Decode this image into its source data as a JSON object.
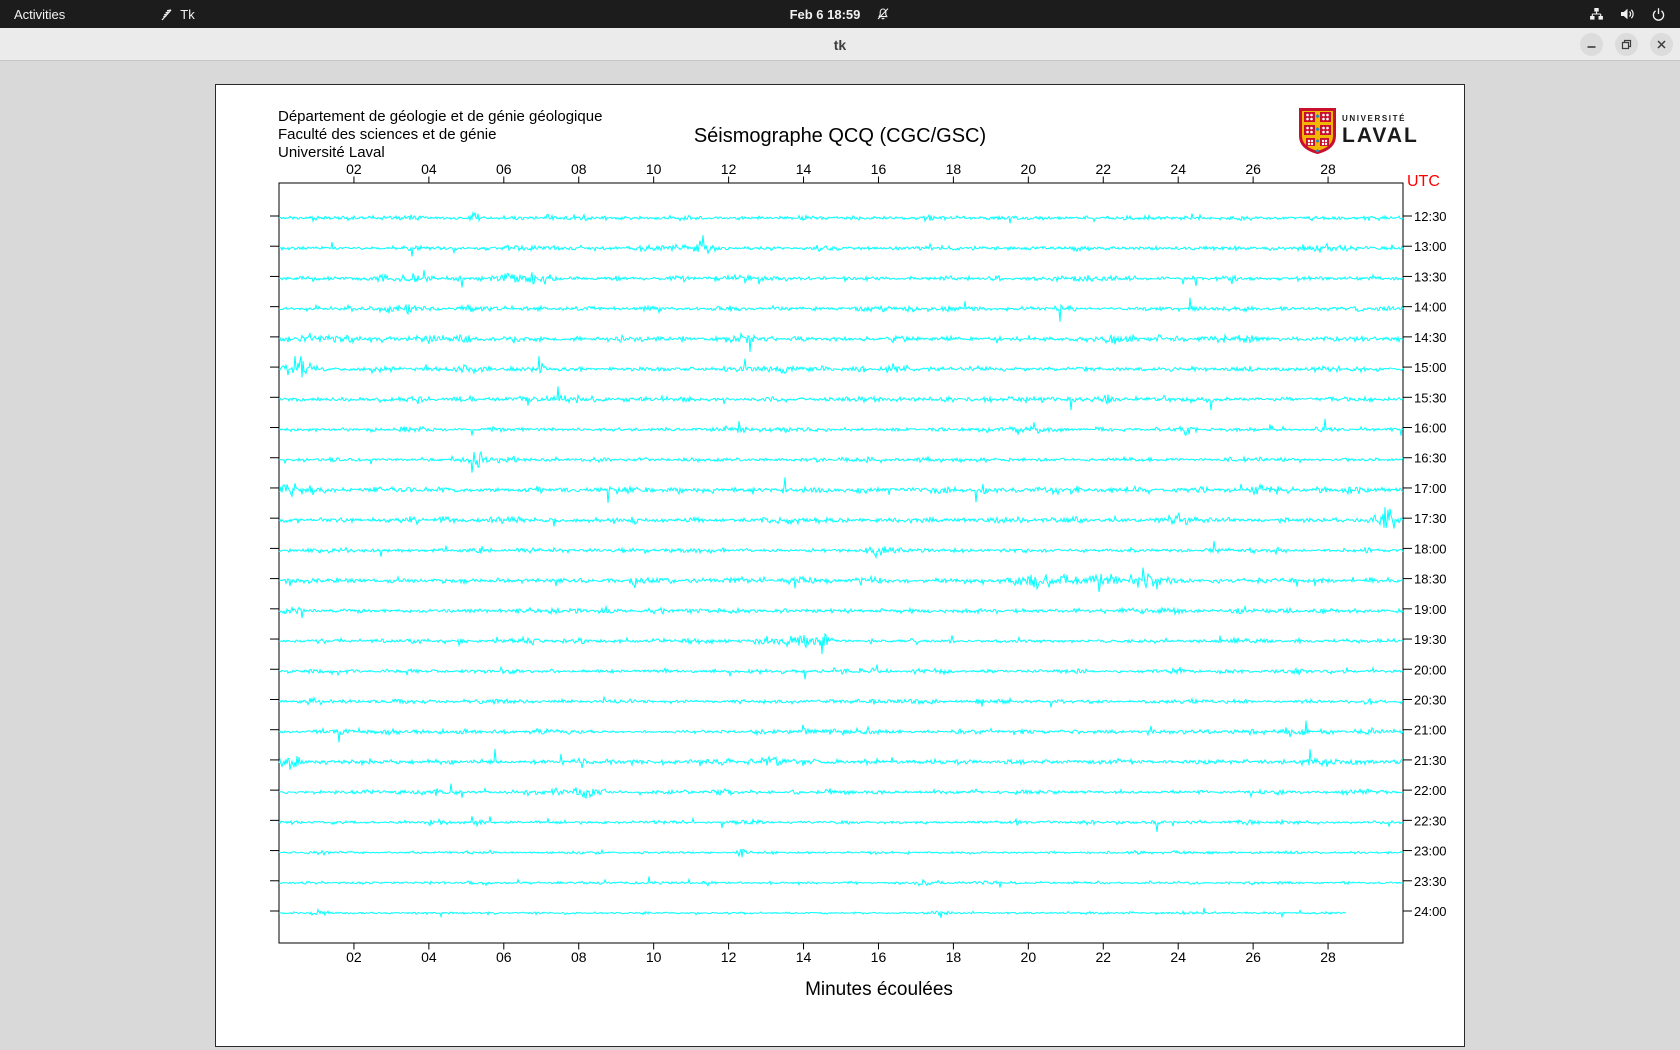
{
  "system_bar": {
    "activities_label": "Activities",
    "app_indicator_label": "Tk",
    "clock": "Feb 6 18:59",
    "icons": [
      "tk-feather-icon",
      "notifications-muted-icon",
      "network-wired-icon",
      "volume-icon",
      "power-icon"
    ]
  },
  "window": {
    "title": "tk",
    "controls": [
      "minimize",
      "restore",
      "close"
    ]
  },
  "header": {
    "institution_lines": [
      "Département de géologie et de génie géologique",
      "Faculté des sciences et de génie",
      "Université Laval"
    ],
    "title": "Séismographe QCQ (CGC/GSC)",
    "logo": {
      "top_text": "UNIVERSITÉ",
      "bottom_text": "LAVAL"
    }
  },
  "colors": {
    "trace": "#00ffff",
    "utc_label": "#ff0000",
    "axis": "#000000",
    "topbar": "#1c1c1c",
    "headerbar": "#ebebeb",
    "tk_background": "#d9d9d9"
  },
  "chart_data": {
    "type": "line",
    "subtype": "helicorder-seismogram",
    "title": "Séismographe QCQ (CGC/GSC)",
    "xlabel": "Minutes écoulées",
    "right_axis_label": "UTC",
    "x_range_minutes": [
      0,
      30
    ],
    "x_tick_step_minutes": 2,
    "x_ticks": [
      "02",
      "04",
      "06",
      "08",
      "10",
      "12",
      "14",
      "16",
      "18",
      "20",
      "22",
      "24",
      "26",
      "28"
    ],
    "row_interval_minutes": 30,
    "rows": [
      {
        "label": "12:30",
        "seed": 11,
        "activity": 0.95,
        "end": 30,
        "events": [
          [
            5.2,
            0.12,
            4.0
          ],
          [
            17.3,
            0.1,
            3.2
          ],
          [
            25.8,
            0.1,
            2.8
          ]
        ]
      },
      {
        "label": "13:00",
        "seed": 23,
        "activity": 0.95,
        "end": 30,
        "events": [
          [
            11.3,
            0.1,
            2.8
          ],
          [
            27.9,
            0.4,
            2.4
          ]
        ]
      },
      {
        "label": "13:30",
        "seed": 37,
        "activity": 1.1,
        "end": 30,
        "events": [
          [
            6.3,
            0.5,
            2.2
          ],
          [
            12.8,
            0.1,
            2.8
          ]
        ]
      },
      {
        "label": "14:00",
        "seed": 41,
        "activity": 1.0,
        "end": 30,
        "events": [
          [
            3.2,
            0.4,
            2.2
          ],
          [
            16.3,
            0.1,
            2.8
          ]
        ]
      },
      {
        "label": "14:30",
        "seed": 53,
        "activity": 1.2,
        "end": 30,
        "events": [
          [
            4.2,
            0.2,
            2.4
          ],
          [
            12.5,
            0.3,
            2.2
          ],
          [
            22.5,
            0.2,
            2.4
          ]
        ]
      },
      {
        "label": "15:00",
        "seed": 67,
        "activity": 1.2,
        "end": 30,
        "events": [
          [
            0.5,
            0.3,
            2.5
          ],
          [
            16.4,
            0.2,
            2.2
          ]
        ]
      },
      {
        "label": "15:30",
        "seed": 71,
        "activity": 1.1,
        "end": 30,
        "events": [
          [
            22.0,
            0.15,
            3.0
          ]
        ]
      },
      {
        "label": "16:00",
        "seed": 83,
        "activity": 0.9,
        "end": 30,
        "events": [
          [
            24.2,
            0.12,
            2.6
          ]
        ]
      },
      {
        "label": "16:30",
        "seed": 97,
        "activity": 0.9,
        "end": 30,
        "events": [
          [
            5.3,
            0.1,
            3.2
          ],
          [
            15.8,
            0.1,
            2.6
          ]
        ]
      },
      {
        "label": "17:00",
        "seed": 101,
        "activity": 1.3,
        "end": 30,
        "events": [
          [
            0.3,
            0.4,
            2.5
          ],
          [
            26.5,
            0.4,
            2.3
          ]
        ]
      },
      {
        "label": "17:30",
        "seed": 113,
        "activity": 1.2,
        "end": 30,
        "events": [
          [
            3.6,
            0.12,
            3.0
          ],
          [
            24.0,
            0.3,
            2.3
          ],
          [
            29.5,
            0.15,
            3.2
          ]
        ]
      },
      {
        "label": "18:00",
        "seed": 127,
        "activity": 1.0,
        "end": 30,
        "events": [
          [
            16.0,
            0.1,
            2.7
          ]
        ]
      },
      {
        "label": "18:30",
        "seed": 131,
        "activity": 1.25,
        "end": 30,
        "events": [
          [
            9.4,
            0.1,
            2.6
          ],
          [
            20.8,
            0.9,
            2.8
          ],
          [
            23.1,
            0.5,
            2.4
          ]
        ]
      },
      {
        "label": "19:00",
        "seed": 139,
        "activity": 1.0,
        "end": 30,
        "events": [
          [
            0.2,
            0.2,
            2.5
          ],
          [
            10.2,
            0.1,
            2.6
          ]
        ]
      },
      {
        "label": "19:30",
        "seed": 149,
        "activity": 0.95,
        "end": 30,
        "events": [
          [
            13.6,
            0.5,
            2.2
          ],
          [
            14.55,
            0.1,
            6.5
          ],
          [
            17.0,
            0.1,
            2.7
          ]
        ]
      },
      {
        "label": "20:00",
        "seed": 151,
        "activity": 0.85,
        "end": 30,
        "events": [
          [
            3.5,
            0.12,
            2.6
          ],
          [
            24.0,
            0.1,
            2.6
          ]
        ]
      },
      {
        "label": "20:30",
        "seed": 163,
        "activity": 0.9,
        "end": 30,
        "events": [
          [
            1.0,
            0.15,
            2.7
          ],
          [
            18.7,
            0.1,
            2.4
          ]
        ]
      },
      {
        "label": "21:00",
        "seed": 173,
        "activity": 1.0,
        "end": 30,
        "events": [
          [
            1.7,
            0.12,
            2.7
          ],
          [
            27.0,
            0.3,
            2.4
          ]
        ]
      },
      {
        "label": "21:30",
        "seed": 181,
        "activity": 1.2,
        "end": 30,
        "events": [
          [
            0.3,
            0.2,
            2.7
          ],
          [
            13.1,
            0.2,
            2.4
          ],
          [
            27.8,
            0.3,
            2.5
          ]
        ]
      },
      {
        "label": "22:00",
        "seed": 193,
        "activity": 0.9,
        "end": 30,
        "events": [
          [
            8.1,
            0.2,
            2.5
          ],
          [
            19.9,
            0.12,
            2.6
          ]
        ]
      },
      {
        "label": "22:30",
        "seed": 199,
        "activity": 0.8,
        "end": 30,
        "events": [
          [
            4.1,
            0.2,
            2.4
          ]
        ]
      },
      {
        "label": "23:00",
        "seed": 211,
        "activity": 0.6,
        "end": 30,
        "events": [
          [
            12.3,
            0.08,
            3.0
          ],
          [
            24.8,
            0.1,
            2.6
          ]
        ]
      },
      {
        "label": "23:30",
        "seed": 223,
        "activity": 0.6,
        "end": 30,
        "events": [
          [
            11.5,
            0.1,
            3.0
          ],
          [
            17.2,
            0.1,
            2.6
          ],
          [
            24.5,
            0.1,
            2.6
          ]
        ]
      },
      {
        "label": "24:00",
        "seed": 229,
        "activity": 0.55,
        "end": 28.5,
        "events": [
          [
            1.0,
            0.15,
            2.6
          ],
          [
            9.7,
            0.1,
            2.4
          ]
        ]
      }
    ]
  }
}
